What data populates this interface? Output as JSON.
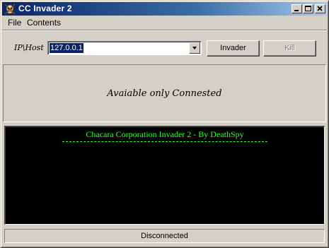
{
  "window": {
    "title": "CC Invader 2",
    "icon": "skull-icon",
    "controls": [
      "minimize-icon",
      "maximize-icon",
      "close-icon"
    ]
  },
  "menu": {
    "items": [
      {
        "label": "File"
      },
      {
        "label": "Contents"
      }
    ]
  },
  "connection": {
    "label": "IP\\Host",
    "value": "127.0.0.1",
    "invader_button": "Invader",
    "kill_button": "Kill"
  },
  "status_panel": {
    "message": "Avaiable only Connested"
  },
  "console": {
    "header": "Chacara Corporation Invader 2 - By DeathSpy",
    "text_color": "#33ff33",
    "background": "#000000"
  },
  "statusbar": {
    "text": "Disconnected"
  },
  "colors": {
    "titlebar_start": "#0a246a",
    "titlebar_end": "#a6caf0",
    "face": "#d4d0c8"
  }
}
